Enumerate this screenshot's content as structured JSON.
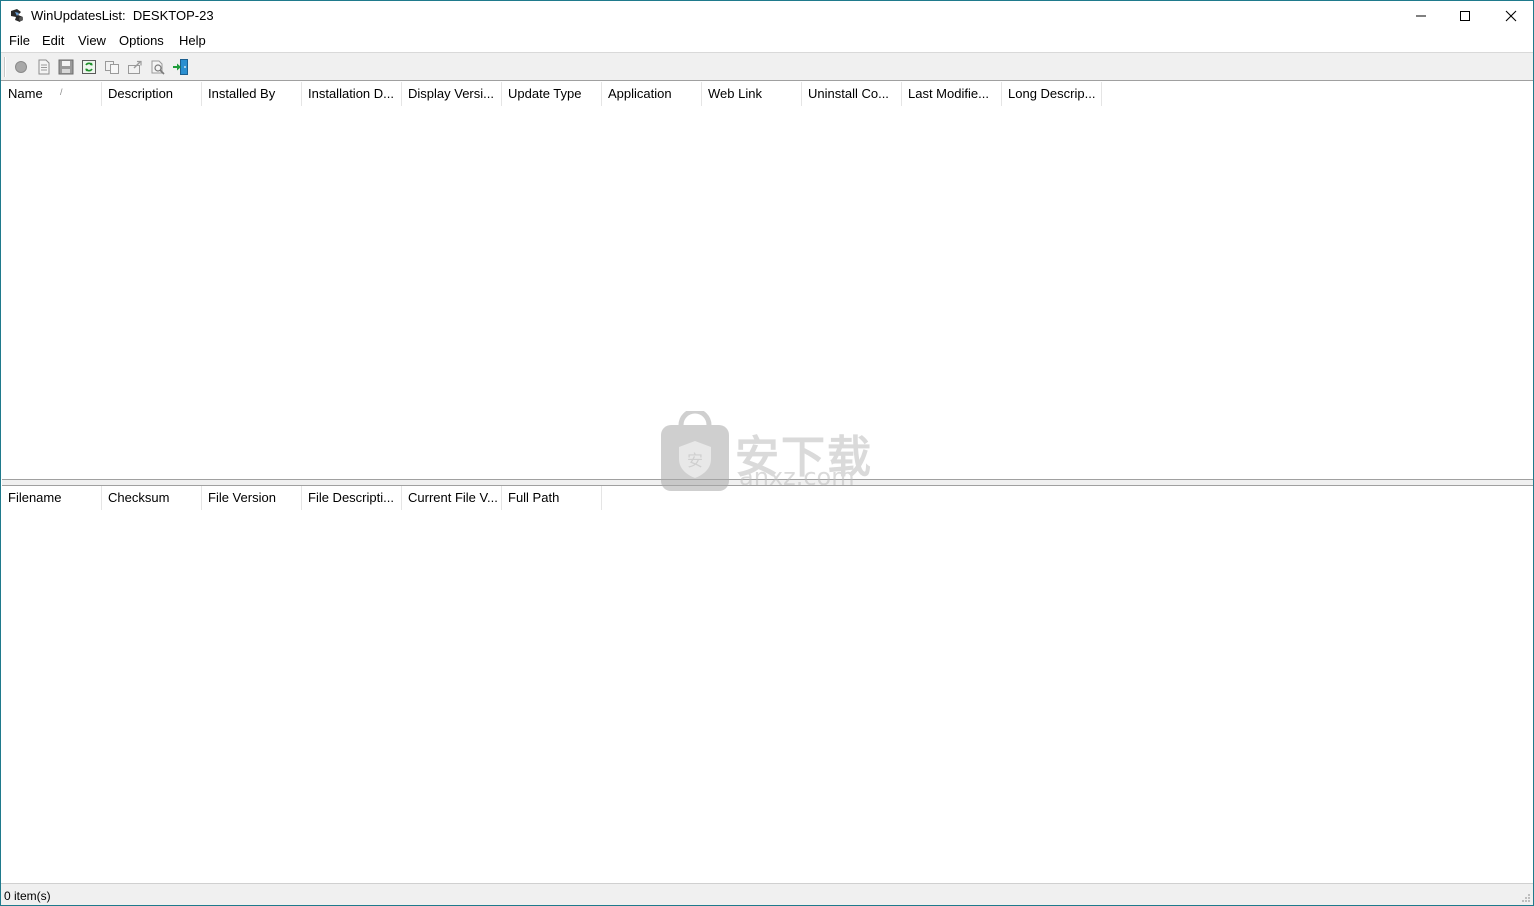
{
  "window": {
    "title": "WinUpdatesList:  DESKTOP-23"
  },
  "menu": [
    "File",
    "Edit",
    "View",
    "Options",
    "Help"
  ],
  "toolbar": {
    "buttons": [
      "record-icon",
      "properties-icon",
      "save-icon",
      "refresh-icon",
      "copy-icon",
      "export-icon",
      "search-icon",
      "exit-icon"
    ]
  },
  "top_list": {
    "columns": [
      "Name",
      "Description",
      "Installed By",
      "Installation D...",
      "Display Versi...",
      "Update Type",
      "Application",
      "Web Link",
      "Uninstall Co...",
      "Last Modifie...",
      "Long Descrip..."
    ],
    "sorted_column_mark": "/",
    "rows": []
  },
  "bottom_list": {
    "columns": [
      "Filename",
      "Checksum",
      "File Version",
      "File Descripti...",
      "Current File V...",
      "Full Path"
    ],
    "rows": []
  },
  "status": {
    "text": "0 item(s)"
  },
  "watermark": {
    "cn": "安下载",
    "en": "anxz.com"
  }
}
